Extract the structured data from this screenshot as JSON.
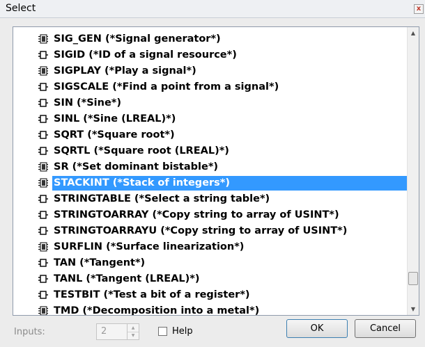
{
  "window": {
    "title": "Select",
    "close_glyph": "x"
  },
  "list": {
    "items": [
      {
        "label": "SIG_GEN (*Signal generator*)",
        "icon": "function-block-icon",
        "selected": false
      },
      {
        "label": "SIGID (*ID of a signal resource*)",
        "icon": "function-icon",
        "selected": false
      },
      {
        "label": "SIGPLAY (*Play a signal*)",
        "icon": "function-block-icon",
        "selected": false
      },
      {
        "label": "SIGSCALE (*Find a point from a signal*)",
        "icon": "function-icon",
        "selected": false
      },
      {
        "label": "SIN (*Sine*)",
        "icon": "function-icon",
        "selected": false
      },
      {
        "label": "SINL (*Sine (LREAL)*)",
        "icon": "function-icon",
        "selected": false
      },
      {
        "label": "SQRT (*Square root*)",
        "icon": "function-icon",
        "selected": false
      },
      {
        "label": "SQRTL (*Square root (LREAL)*)",
        "icon": "function-icon",
        "selected": false
      },
      {
        "label": "SR (*Set dominant bistable*)",
        "icon": "function-block-icon",
        "selected": false
      },
      {
        "label": "STACKINT (*Stack of integers*)",
        "icon": "function-block-icon",
        "selected": true
      },
      {
        "label": "STRINGTABLE (*Select a string table*)",
        "icon": "function-icon",
        "selected": false
      },
      {
        "label": "STRINGTOARRAY (*Copy string to array of USINT*)",
        "icon": "function-icon",
        "selected": false
      },
      {
        "label": "STRINGTOARRAYU (*Copy string to array of USINT*)",
        "icon": "function-icon",
        "selected": false
      },
      {
        "label": "SURFLIN (*Surface linearization*)",
        "icon": "function-block-icon",
        "selected": false
      },
      {
        "label": "TAN (*Tangent*)",
        "icon": "function-icon",
        "selected": false
      },
      {
        "label": "TANL (*Tangent (LREAL)*)",
        "icon": "function-icon",
        "selected": false
      },
      {
        "label": "TESTBIT (*Test a bit of a register*)",
        "icon": "function-icon",
        "selected": false
      },
      {
        "label": "TMD (*Decomposition into a metal*)",
        "icon": "function-block-icon",
        "selected": false
      }
    ],
    "scroll_position": 0.86
  },
  "footer": {
    "inputs_label": "Inputs:",
    "inputs_value": "2",
    "help_label": "Help",
    "help_checked": false,
    "ok_label": "OK",
    "cancel_label": "Cancel"
  },
  "colors": {
    "selection": "#3399ff",
    "selection_text": "#ffffff"
  }
}
